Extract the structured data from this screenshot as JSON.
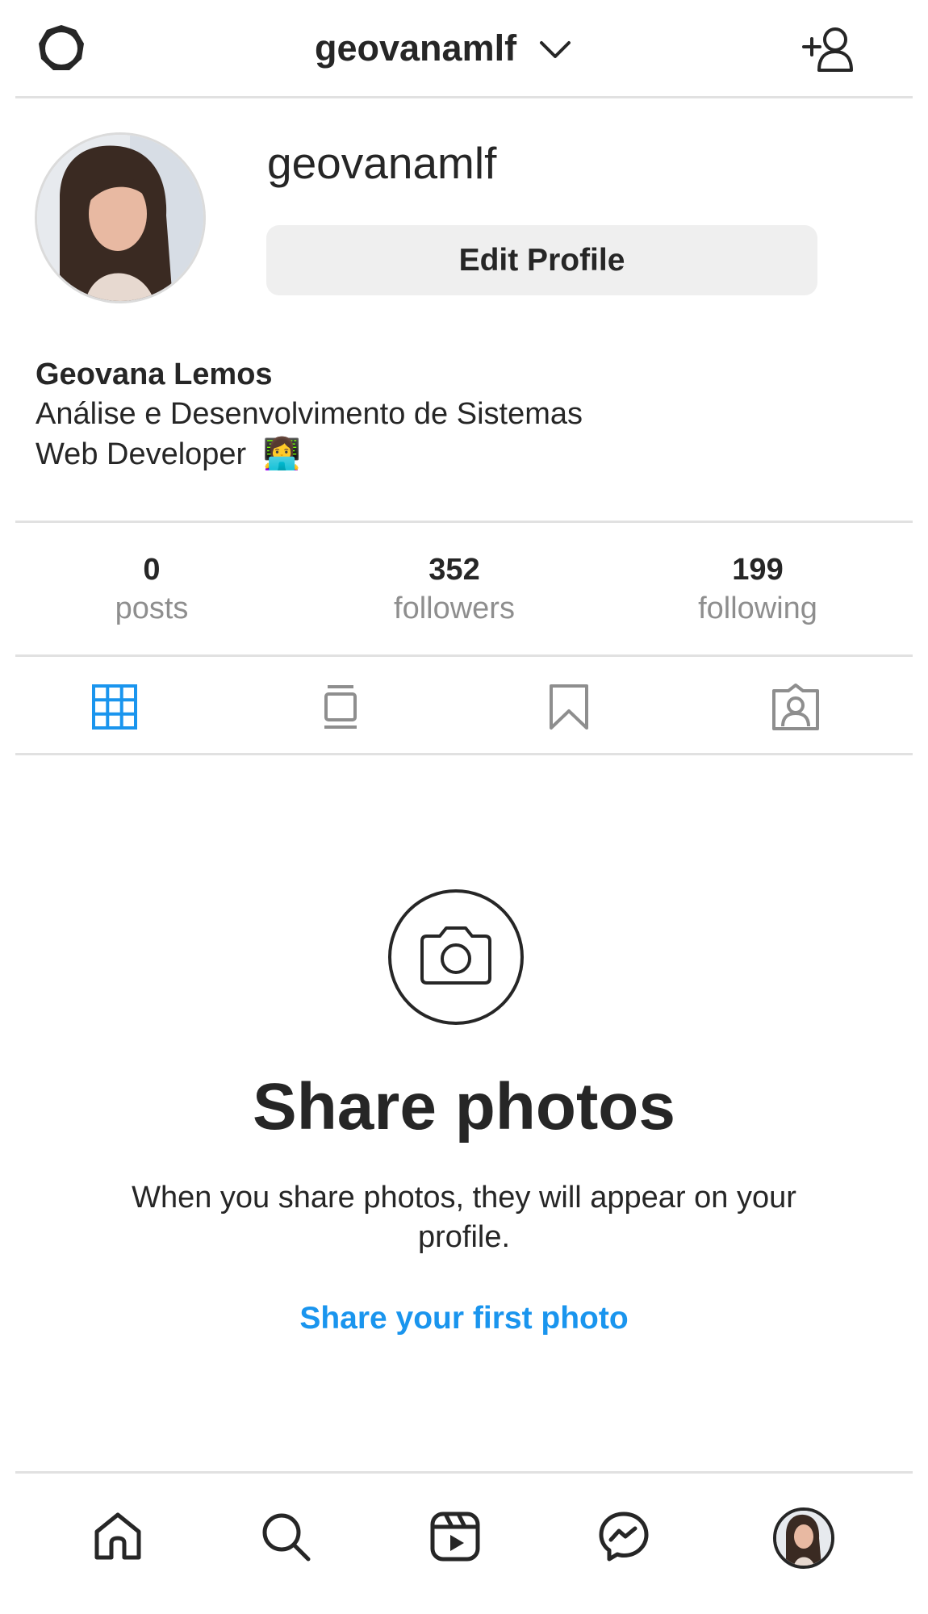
{
  "header": {
    "username": "geovanamlf",
    "settings_icon": "gear-icon",
    "dropdown_icon": "chevron-down-icon",
    "add_user_icon": "add-user-icon"
  },
  "profile": {
    "username": "geovanamlf",
    "edit_button_label": "Edit Profile",
    "bio": {
      "name": "Geovana Lemos",
      "line1": "Análise e Desenvolvimento de Sistemas",
      "line2": "Web Developer",
      "line2_emoji": "👩‍💻"
    }
  },
  "stats": [
    {
      "value": "0",
      "label": "posts"
    },
    {
      "value": "352",
      "label": "followers"
    },
    {
      "value": "199",
      "label": "following"
    }
  ],
  "tabs": [
    {
      "icon": "grid-icon",
      "active": true
    },
    {
      "icon": "igtv-icon",
      "active": false
    },
    {
      "icon": "bookmark-icon",
      "active": false
    },
    {
      "icon": "tagged-icon",
      "active": false
    }
  ],
  "empty_state": {
    "icon": "camera-icon",
    "title": "Share photos",
    "description": "When you share photos, they will appear on your profile.",
    "link": "Share your first photo"
  },
  "bottom_nav": [
    {
      "icon": "home-icon"
    },
    {
      "icon": "search-icon"
    },
    {
      "icon": "reels-icon"
    },
    {
      "icon": "messenger-icon"
    },
    {
      "icon": "profile-avatar"
    }
  ],
  "colors": {
    "accent": "#1a95ee",
    "text": "#262626",
    "muted": "#8e8e8e",
    "divider": "#e1e1e1",
    "button_bg": "#efefef"
  }
}
